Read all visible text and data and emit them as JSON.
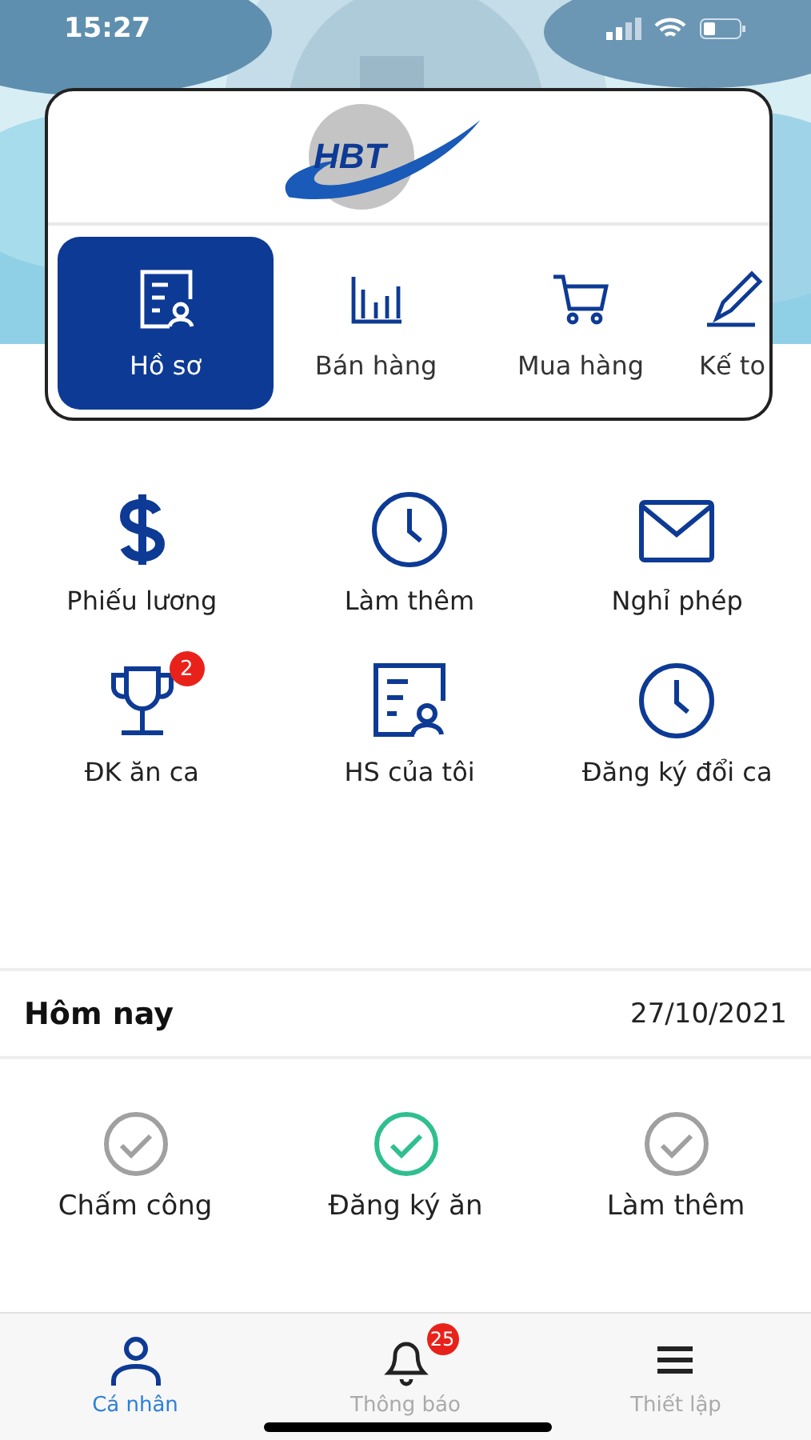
{
  "status_bar": {
    "time": "15:27"
  },
  "logo": {
    "text": "HBT"
  },
  "modules": [
    {
      "label": "Hồ sơ",
      "selected": true
    },
    {
      "label": "Bán hàng",
      "selected": false
    },
    {
      "label": "Mua hàng",
      "selected": false
    },
    {
      "label": "Kế to",
      "selected": false
    }
  ],
  "shortcuts": [
    {
      "label": "Phiếu lương"
    },
    {
      "label": "Làm thêm"
    },
    {
      "label": "Nghỉ phép"
    },
    {
      "label": "ĐK ăn ca",
      "badge": "2"
    },
    {
      "label": "HS của tôi"
    },
    {
      "label": "Đăng ký đổi ca"
    }
  ],
  "today": {
    "title": "Hôm nay",
    "date": "27/10/2021",
    "items": [
      {
        "label": "Chấm công",
        "done": false
      },
      {
        "label": "Đăng ký ăn",
        "done": true
      },
      {
        "label": "Làm thêm",
        "done": false
      }
    ]
  },
  "tab_bar": [
    {
      "label": "Cá nhân",
      "selected": true
    },
    {
      "label": "Thông báo",
      "selected": false,
      "badge": "25"
    },
    {
      "label": "Thiết lập",
      "selected": false
    }
  ]
}
